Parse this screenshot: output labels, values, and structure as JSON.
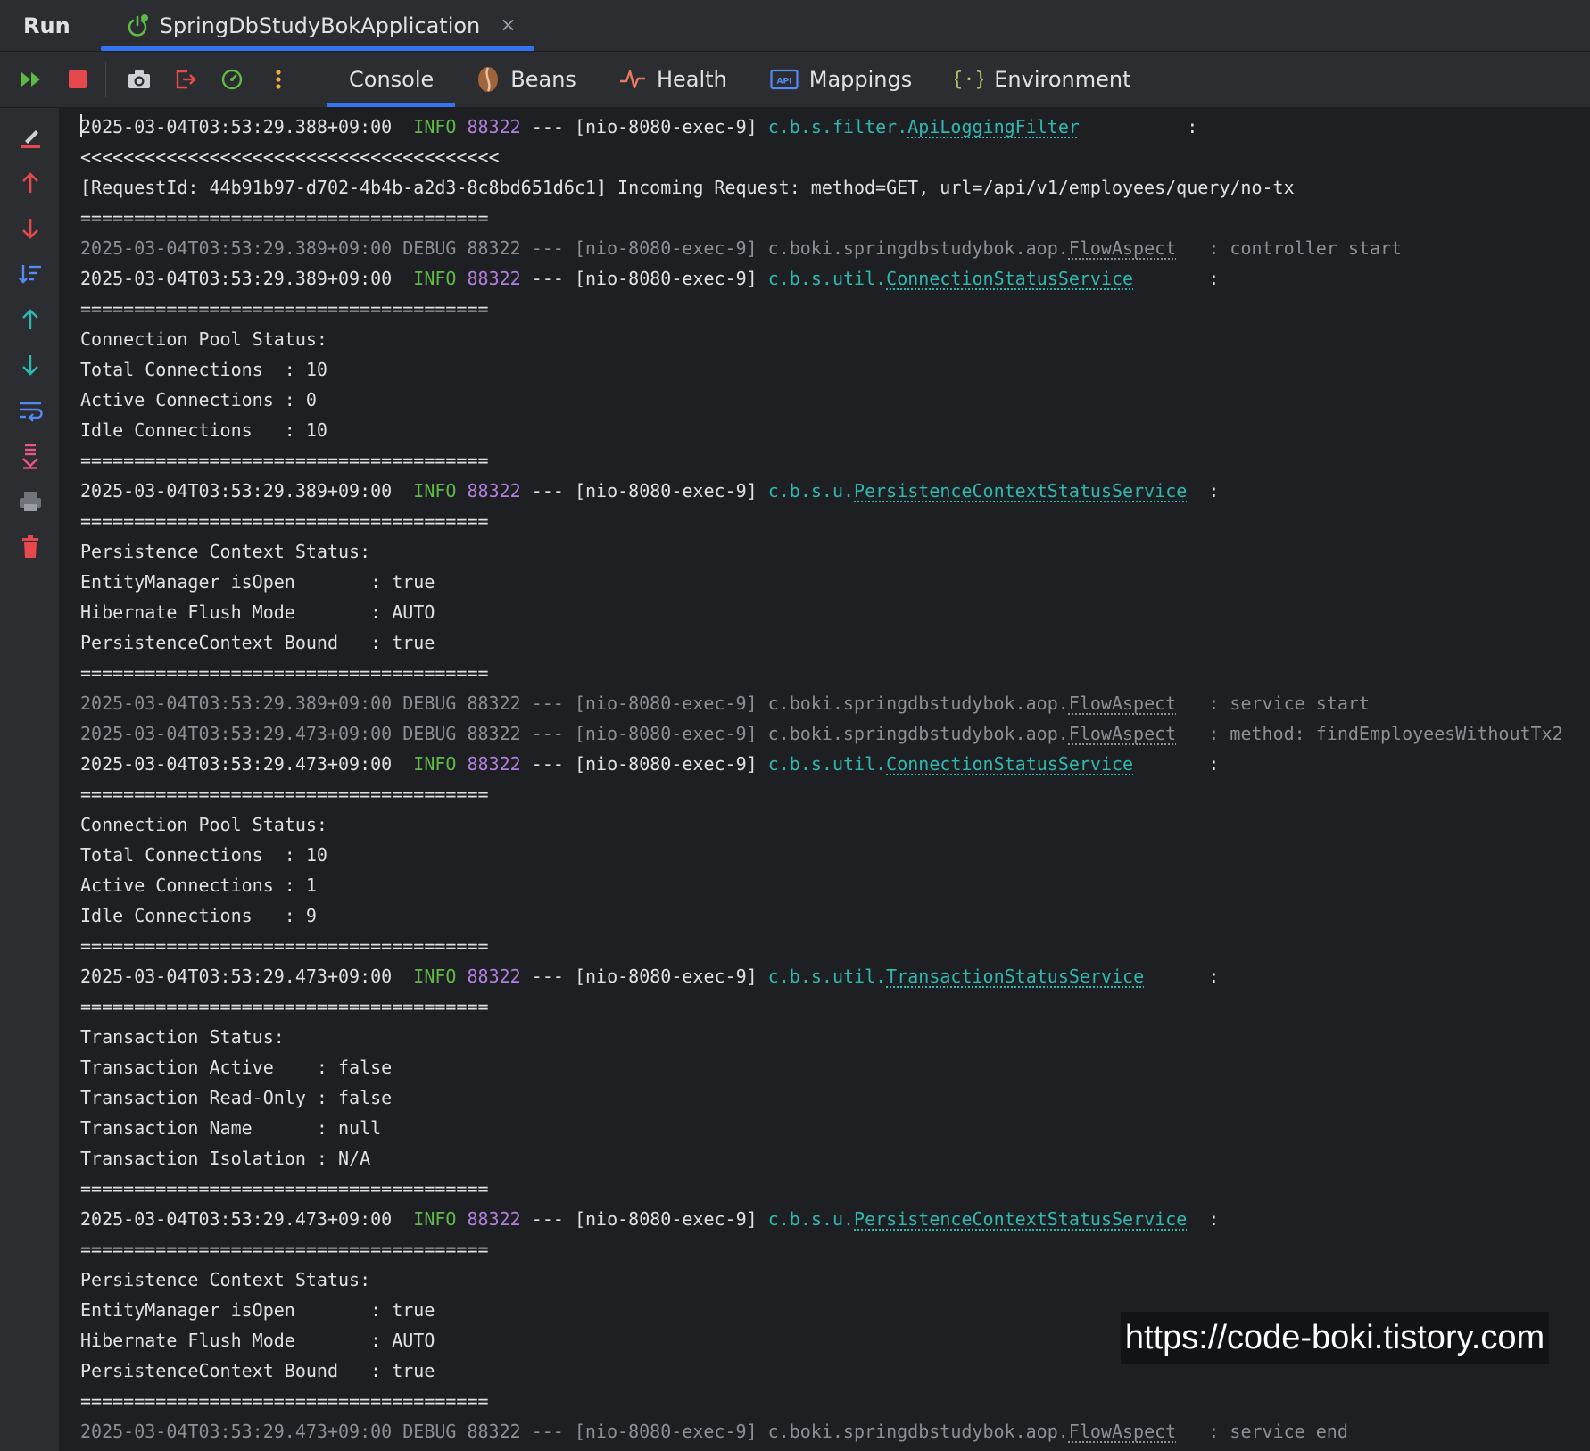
{
  "topbar": {
    "run_label": "Run",
    "tab_title": "SpringDbStudyBokApplication",
    "close_glyph": "×"
  },
  "toolbar": {
    "subtabs": [
      "Console",
      "Beans",
      "Health",
      "Mappings",
      "Environment"
    ],
    "icons": [
      "rerun-icon",
      "stop-icon",
      "camera-icon",
      "exit-icon",
      "profiler-icon",
      "more-icon"
    ]
  },
  "console": {
    "lines": [
      {
        "kind": "log",
        "ts": "2025-03-04T03:53:29.388+09:00",
        "level": " INFO",
        "pid": "88322",
        "sep": " --- ",
        "thread": "[nio-8080-exec-9]",
        "pkg": "c.b.s.filter.",
        "cls": "ApiLoggingFilter",
        "pad": "         ",
        "msg": " :"
      },
      {
        "kind": "text",
        "text": "<<<<<<<<<<<<<<<<<<<<<<<<<<<<<<<<<<<<<<<"
      },
      {
        "kind": "text",
        "text": "[RequestId: 44b91b97-d702-4b4b-a2d3-8c8bd651d6c1] Incoming Request: method=GET, url=/api/v1/employees/query/no-tx"
      },
      {
        "kind": "text",
        "text": "======================================"
      },
      {
        "kind": "debug",
        "text": "2025-03-04T03:53:29.389+09:00 DEBUG 88322 --- [nio-8080-exec-9] c.boki.springdbstudybok.aop.",
        "cls": "FlowAspect",
        "msg": "   : controller start"
      },
      {
        "kind": "log",
        "ts": "2025-03-04T03:53:29.389+09:00",
        "level": " INFO",
        "pid": "88322",
        "sep": " --- ",
        "thread": "[nio-8080-exec-9]",
        "pkg": "c.b.s.util.",
        "cls": "ConnectionStatusService",
        "pad": "      ",
        "msg": " :"
      },
      {
        "kind": "text",
        "text": "======================================"
      },
      {
        "kind": "text",
        "text": "Connection Pool Status:"
      },
      {
        "kind": "text",
        "text": "Total Connections  : 10"
      },
      {
        "kind": "text",
        "text": "Active Connections : 0"
      },
      {
        "kind": "text",
        "text": "Idle Connections   : 10"
      },
      {
        "kind": "text",
        "text": "======================================"
      },
      {
        "kind": "log",
        "ts": "2025-03-04T03:53:29.389+09:00",
        "level": " INFO",
        "pid": "88322",
        "sep": " --- ",
        "thread": "[nio-8080-exec-9]",
        "pkg": "c.b.s.u.",
        "cls": "PersistenceContextStatusService",
        "pad": "  ",
        "msg": ":"
      },
      {
        "kind": "text",
        "text": "======================================"
      },
      {
        "kind": "text",
        "text": "Persistence Context Status:"
      },
      {
        "kind": "text",
        "text": "EntityManager isOpen       : true"
      },
      {
        "kind": "text",
        "text": "Hibernate Flush Mode       : AUTO"
      },
      {
        "kind": "text",
        "text": "PersistenceContext Bound   : true"
      },
      {
        "kind": "text",
        "text": "======================================"
      },
      {
        "kind": "debug",
        "text": "2025-03-04T03:53:29.389+09:00 DEBUG 88322 --- [nio-8080-exec-9] c.boki.springdbstudybok.aop.",
        "cls": "FlowAspect",
        "msg": "   : service start"
      },
      {
        "kind": "debug",
        "text": "2025-03-04T03:53:29.473+09:00 DEBUG 88322 --- [nio-8080-exec-9] c.boki.springdbstudybok.aop.",
        "cls": "FlowAspect",
        "msg": "   : method: findEmployeesWithoutTx2"
      },
      {
        "kind": "log",
        "ts": "2025-03-04T03:53:29.473+09:00",
        "level": " INFO",
        "pid": "88322",
        "sep": " --- ",
        "thread": "[nio-8080-exec-9]",
        "pkg": "c.b.s.util.",
        "cls": "ConnectionStatusService",
        "pad": "      ",
        "msg": " :"
      },
      {
        "kind": "text",
        "text": "======================================"
      },
      {
        "kind": "text",
        "text": "Connection Pool Status:"
      },
      {
        "kind": "text",
        "text": "Total Connections  : 10"
      },
      {
        "kind": "text",
        "text": "Active Connections : 1"
      },
      {
        "kind": "text",
        "text": "Idle Connections   : 9"
      },
      {
        "kind": "text",
        "text": "======================================"
      },
      {
        "kind": "log",
        "ts": "2025-03-04T03:53:29.473+09:00",
        "level": " INFO",
        "pid": "88322",
        "sep": " --- ",
        "thread": "[nio-8080-exec-9]",
        "pkg": "c.b.s.util.",
        "cls": "TransactionStatusService",
        "pad": "      ",
        "msg": ":"
      },
      {
        "kind": "text",
        "text": "======================================"
      },
      {
        "kind": "text",
        "text": "Transaction Status:"
      },
      {
        "kind": "text",
        "text": "Transaction Active    : false"
      },
      {
        "kind": "text",
        "text": "Transaction Read-Only : false"
      },
      {
        "kind": "text",
        "text": "Transaction Name      : null"
      },
      {
        "kind": "text",
        "text": "Transaction Isolation : N/A"
      },
      {
        "kind": "text",
        "text": "======================================"
      },
      {
        "kind": "log",
        "ts": "2025-03-04T03:53:29.473+09:00",
        "level": " INFO",
        "pid": "88322",
        "sep": " --- ",
        "thread": "[nio-8080-exec-9]",
        "pkg": "c.b.s.u.",
        "cls": "PersistenceContextStatusService",
        "pad": "  ",
        "msg": ":"
      },
      {
        "kind": "text",
        "text": "======================================"
      },
      {
        "kind": "text",
        "text": "Persistence Context Status:"
      },
      {
        "kind": "text",
        "text": "EntityManager isOpen       : true"
      },
      {
        "kind": "text",
        "text": "Hibernate Flush Mode       : AUTO"
      },
      {
        "kind": "text",
        "text": "PersistenceContext Bound   : true"
      },
      {
        "kind": "text",
        "text": "======================================"
      },
      {
        "kind": "debug",
        "text": "2025-03-04T03:53:29.473+09:00 DEBUG 88322 --- [nio-8080-exec-9] c.boki.springdbstudybok.aop.",
        "cls": "FlowAspect",
        "msg": "   : service end"
      }
    ]
  },
  "watermark": "https://code-boki.tistory.com",
  "colors": {
    "accent": "#3574f0",
    "info": "#5fb946",
    "pid": "#b07fdc",
    "logger": "#2fb8b0",
    "debug": "#8c8f94",
    "stop": "#e5484d"
  }
}
